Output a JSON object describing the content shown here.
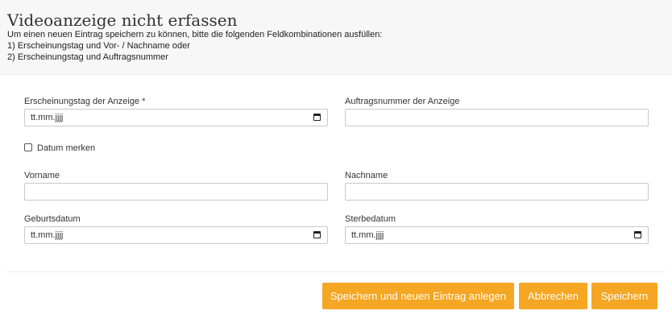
{
  "header": {
    "title": "Videoanzeige nicht erfassen",
    "hints": [
      "Um einen neuen Eintrag speichern zu können, bitte die folgenden Feldkombinationen ausfüllen:",
      "1) Erscheinungstag und Vor- / Nachname oder",
      "2) Erscheinungstag und Auftragsnummer"
    ]
  },
  "form": {
    "erscheinungstag": {
      "label": "Erscheinungstag der Anzeige *",
      "placeholder": "tt.mm.jjjj",
      "icon": "calendar-icon"
    },
    "auftragsnummer": {
      "label": "Auftragsnummer der Anzeige",
      "value": ""
    },
    "datum_merken": {
      "label": "Datum merken",
      "checked": false
    },
    "vorname": {
      "label": "Vorname",
      "value": ""
    },
    "nachname": {
      "label": "Nachname",
      "value": ""
    },
    "geburtsdatum": {
      "label": "Geburtsdatum",
      "placeholder": "tt.mm.jjjj",
      "icon": "calendar-icon"
    },
    "sterbedatum": {
      "label": "Sterbedatum",
      "placeholder": "tt.mm.jjjj",
      "icon": "calendar-icon"
    }
  },
  "actions": {
    "save_and_new": "Speichern und neuen Eintrag anlegen",
    "cancel": "Abbrechen",
    "save": "Speichern"
  },
  "colors": {
    "accent": "#f5a623",
    "header_bg": "#f7f7f7",
    "border": "#c9c9c9"
  }
}
